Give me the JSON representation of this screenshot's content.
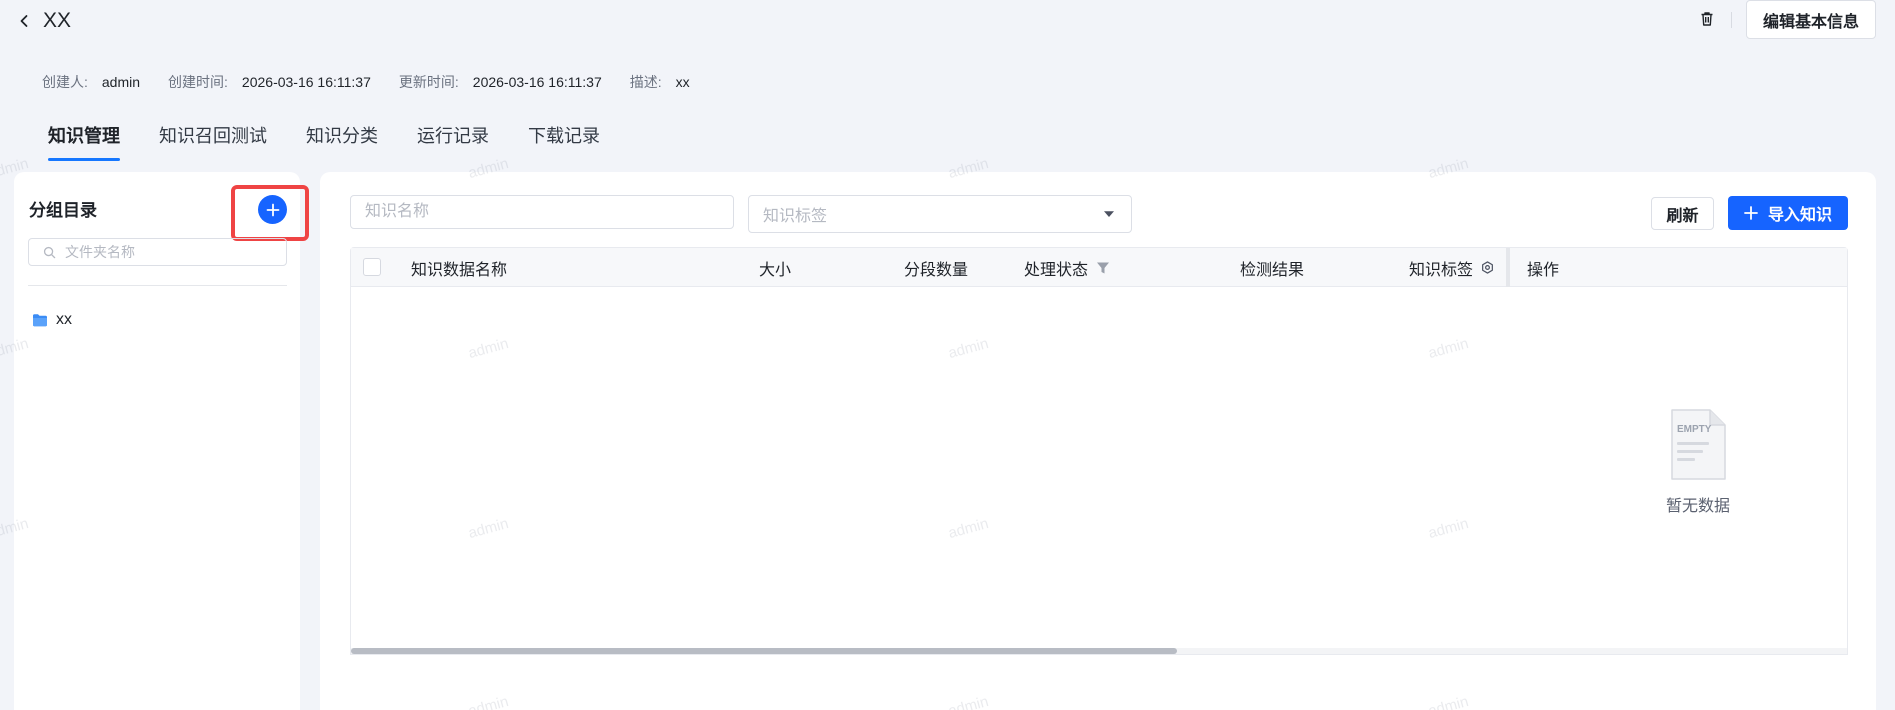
{
  "header": {
    "title": "XX",
    "edit_label": "编辑基本信息"
  },
  "meta": {
    "creator_label": "创建人:",
    "creator_value": "admin",
    "created_label": "创建时间:",
    "created_value": "2026-03-16 16:11:37",
    "updated_label": "更新时间:",
    "updated_value": "2026-03-16 16:11:37",
    "desc_label": "描述:",
    "desc_value": "xx"
  },
  "tabs": [
    {
      "label": "知识管理",
      "active": true
    },
    {
      "label": "知识召回测试",
      "active": false
    },
    {
      "label": "知识分类",
      "active": false
    },
    {
      "label": "运行记录",
      "active": false
    },
    {
      "label": "下载记录",
      "active": false
    }
  ],
  "sidebar": {
    "title": "分组目录",
    "search_placeholder": "文件夹名称",
    "folders": [
      {
        "name": "xx"
      }
    ]
  },
  "filters": {
    "name_placeholder": "知识名称",
    "tag_placeholder": "知识标签",
    "refresh_label": "刷新",
    "import_label": "导入知识"
  },
  "table": {
    "columns": [
      "知识数据名称",
      "大小",
      "分段数量",
      "处理状态",
      "检测结果",
      "知识标签",
      "操作"
    ],
    "rows": [],
    "empty_image_text": "EMPTY",
    "empty_text": "暂无数据"
  },
  "watermark": "admin",
  "colors": {
    "primary": "#1664ff",
    "highlight": "#ef4444",
    "background": "#f2f4f9"
  }
}
